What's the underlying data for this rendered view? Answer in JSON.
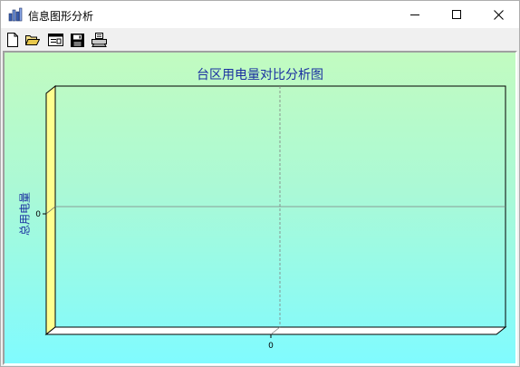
{
  "window": {
    "title": "信息图形分析",
    "app_icon": "chart-app-icon",
    "controls": {
      "minimize_icon": "minimize-icon",
      "maximize_icon": "maximize-icon",
      "close_icon": "close-icon"
    }
  },
  "toolbar": {
    "buttons": [
      {
        "name": "new-button",
        "icon": "new-document-icon"
      },
      {
        "name": "open-button",
        "icon": "open-folder-icon"
      },
      {
        "name": "data-button",
        "icon": "data-table-icon"
      },
      {
        "name": "save-button",
        "icon": "save-disk-icon"
      },
      {
        "name": "print-button",
        "icon": "printer-icon"
      }
    ]
  },
  "chart_data": {
    "type": "bar",
    "title": "台区用电量对比分析图",
    "xlabel": "",
    "ylabel": "总用电量",
    "categories": [],
    "series": [],
    "x_ticks": [
      "0"
    ],
    "y_ticks": [
      "0"
    ],
    "grid": true,
    "style": "3d",
    "background_gradient": [
      "#c2fbc0",
      "#80fbff"
    ],
    "title_color": "#1a2fa0"
  }
}
